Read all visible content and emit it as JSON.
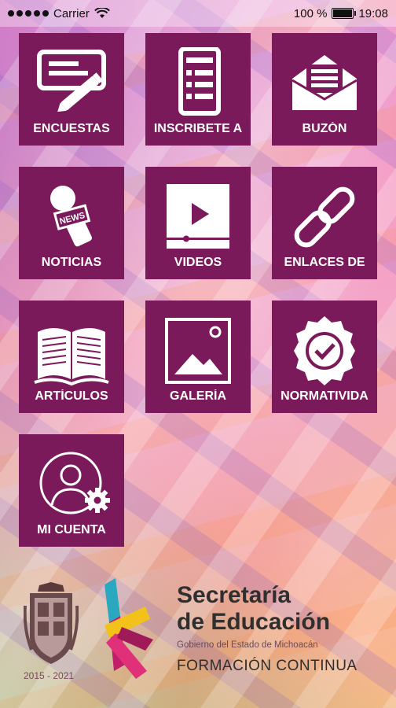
{
  "status_bar": {
    "carrier": "Carrier",
    "battery_percent": "100 %",
    "time": "19:08",
    "battery_level": 1.0
  },
  "tiles": [
    {
      "label": "ENCUESTAS",
      "icon": "survey-icon"
    },
    {
      "label": "INSCRIBETE A",
      "icon": "form-icon"
    },
    {
      "label": "BUZÓN",
      "icon": "envelope-icon"
    },
    {
      "label": "NOTICIAS",
      "icon": "news-microphone-icon"
    },
    {
      "label": "VIDEOS",
      "icon": "video-player-icon"
    },
    {
      "label": "ENLACES DE",
      "icon": "chain-link-icon"
    },
    {
      "label": "ARTÍCULOS",
      "icon": "open-book-icon"
    },
    {
      "label": "GALERÍA",
      "icon": "image-icon"
    },
    {
      "label": "NORMATIVIDA",
      "icon": "badge-check-icon"
    },
    {
      "label": "MI CUENTA",
      "icon": "user-settings-icon"
    }
  ],
  "footer": {
    "years": "2015 - 2021",
    "brand_line1": "Secretaría",
    "brand_line2": "de Educación",
    "brand_line3": "Gobierno del Estado de Michoacán",
    "brand_line4": "FORMACIÓN CONTINUA"
  },
  "colors": {
    "tile_background": "#7b1a5a",
    "tile_text": "#ffffff",
    "brand_text": "#2f2f2f"
  }
}
